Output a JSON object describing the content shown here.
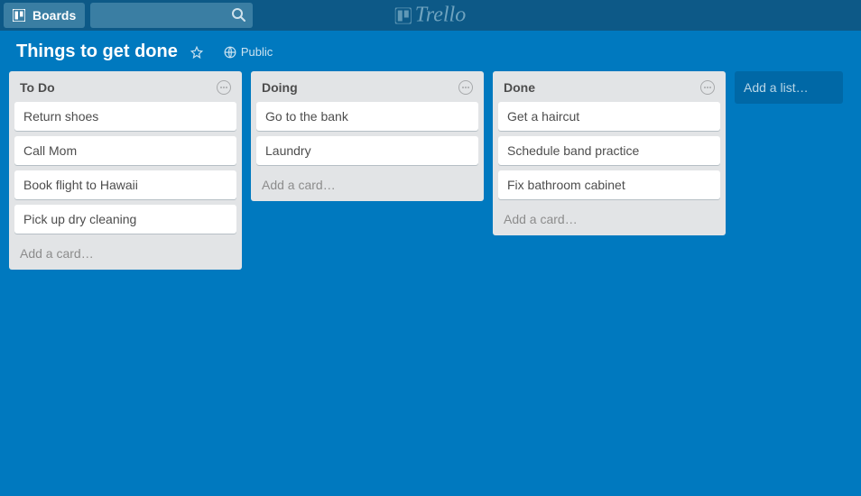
{
  "nav": {
    "boards_label": "Boards",
    "brand": "Trello"
  },
  "board_header": {
    "title": "Things to get done",
    "visibility_label": "Public"
  },
  "lists": [
    {
      "name": "To Do",
      "cards": [
        "Return shoes",
        "Call Mom",
        "Book flight to Hawaii",
        "Pick up dry cleaning"
      ]
    },
    {
      "name": "Doing",
      "cards": [
        "Go to the bank",
        "Laundry"
      ]
    },
    {
      "name": "Done",
      "cards": [
        "Get a haircut",
        "Schedule band practice",
        "Fix bathroom cabinet"
      ]
    }
  ],
  "ui": {
    "add_card": "Add a card…",
    "add_list": "Add a list…"
  },
  "colors": {
    "board_bg": "#0079bf",
    "topbar_bg": "#0d5987",
    "list_bg": "#e2e4e6",
    "card_bg": "#ffffff"
  }
}
